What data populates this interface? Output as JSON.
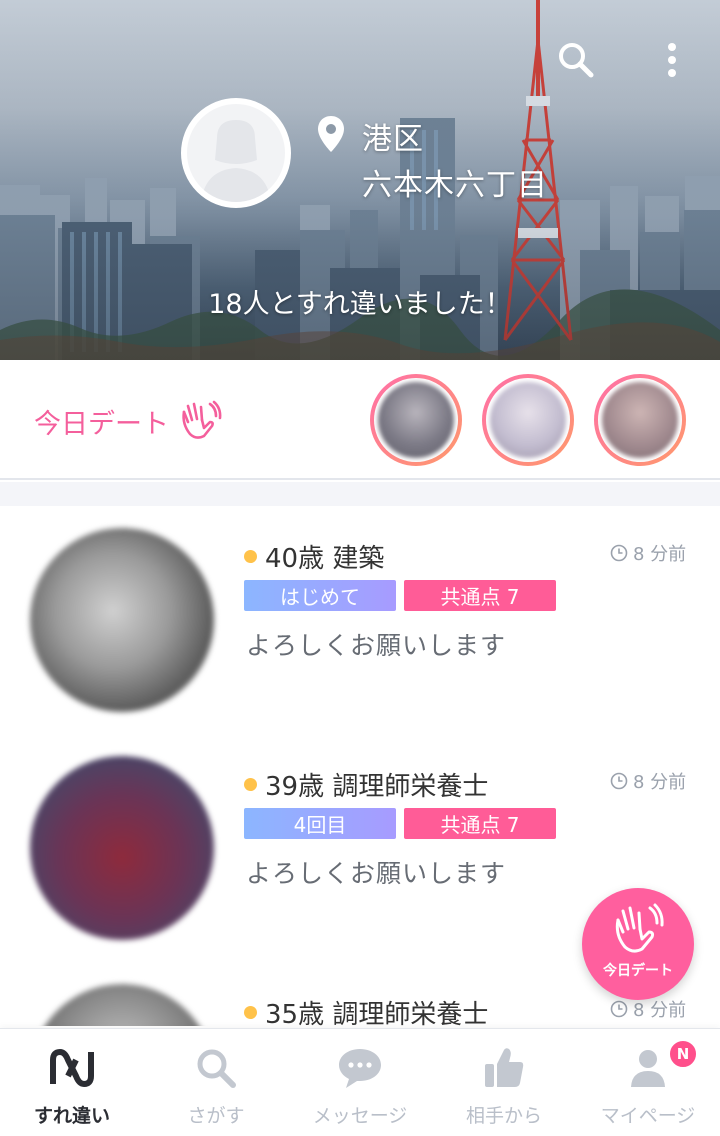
{
  "header": {
    "location_line1": "港区",
    "location_line2": "六本木六丁目",
    "passed_message": "18人とすれ違いました！"
  },
  "today_date": {
    "label": "今日デート",
    "avatar_colors": [
      "#8a8a94",
      "#b9b4c4",
      "#9e8e8e"
    ]
  },
  "list": [
    {
      "title": "40歳 建築",
      "time": "8 分前",
      "badge1": "はじめて",
      "badge2": "共通点 7",
      "message": "よろしくお願いします"
    },
    {
      "title": "39歳 調理師栄養士",
      "time": "8 分前",
      "badge1": "4回目",
      "badge2": "共通点 7",
      "message": "よろしくお願いします"
    },
    {
      "title": "35歳 調理師栄養士",
      "time": "8 分前"
    }
  ],
  "fab": {
    "label": "今日デート"
  },
  "nav": {
    "items": [
      {
        "label": "すれ違い",
        "icon": "passing-icon",
        "active": true
      },
      {
        "label": "さがす",
        "icon": "search-icon"
      },
      {
        "label": "メッセージ",
        "icon": "chat-icon"
      },
      {
        "label": "相手から",
        "icon": "thumbs-up-icon"
      },
      {
        "label": "マイページ",
        "icon": "person-icon",
        "badge": "N"
      }
    ]
  },
  "colors": {
    "accent_pink": "#ff5c97",
    "badge_blue_start": "#8cb6ff",
    "badge_blue_end": "#a79bff",
    "online_dot": "#ffc24a"
  }
}
